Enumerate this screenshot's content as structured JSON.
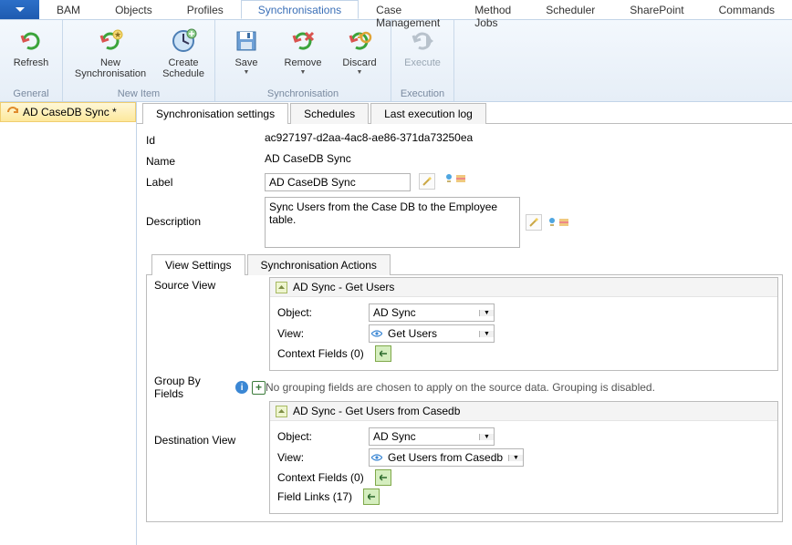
{
  "menu": {
    "tabs": [
      "BAM",
      "Objects",
      "Profiles",
      "Synchronisations",
      "Case Management",
      "Method Jobs",
      "Scheduler",
      "SharePoint",
      "Commands"
    ],
    "active": 3
  },
  "ribbon": {
    "groups": [
      {
        "label": "General",
        "buttons": [
          {
            "label": "Refresh",
            "icon": "refresh",
            "interact": true
          }
        ]
      },
      {
        "label": "New Item",
        "buttons": [
          {
            "label": "New Synchronisation",
            "icon": "new-sync",
            "interact": true,
            "wide": true
          },
          {
            "label": "Create Schedule",
            "icon": "clock",
            "interact": true
          }
        ]
      },
      {
        "label": "Synchronisation",
        "buttons": [
          {
            "label": "Save",
            "icon": "save",
            "interact": true,
            "dropdown": true
          },
          {
            "label": "Remove",
            "icon": "remove",
            "interact": true,
            "dropdown": true
          },
          {
            "label": "Discard",
            "icon": "discard",
            "interact": true,
            "dropdown": true
          }
        ]
      },
      {
        "label": "Execution",
        "buttons": [
          {
            "label": "Execute",
            "icon": "execute",
            "interact": false
          }
        ]
      }
    ]
  },
  "tree": {
    "items": [
      {
        "label": "AD CaseDB Sync *"
      }
    ]
  },
  "tabs": {
    "items": [
      "Synchronisation settings",
      "Schedules",
      "Last execution log"
    ],
    "active": 0
  },
  "form": {
    "id_label": "Id",
    "id_value": "ac927197-d2aa-4ac8-ae86-371da73250ea",
    "name_label": "Name",
    "name_value": "AD CaseDB Sync",
    "label_label": "Label",
    "label_value": "AD CaseDB Sync",
    "desc_label": "Description",
    "desc_value": "Sync Users from the Case DB to the Employee table."
  },
  "subtabs": {
    "items": [
      "View Settings",
      "Synchronisation Actions"
    ],
    "active": 0
  },
  "source": {
    "section": "Source View",
    "header": "AD Sync   - Get Users",
    "object_label": "Object:",
    "object_value": "AD Sync",
    "view_label": "View:",
    "view_value": "Get Users",
    "context_label": "Context Fields  (0)"
  },
  "group_by": {
    "label": "Group By Fields",
    "text": "No grouping fields are chosen to apply on the source data. Grouping is disabled."
  },
  "dest": {
    "section": "Destination View",
    "header": "AD Sync   - Get Users from Casedb",
    "object_label": "Object:",
    "object_value": "AD Sync",
    "view_label": "View:",
    "view_value": "Get Users from Casedb",
    "context_label": "Context Fields  (0)",
    "fieldlinks_label": "Field Links  (17)"
  }
}
